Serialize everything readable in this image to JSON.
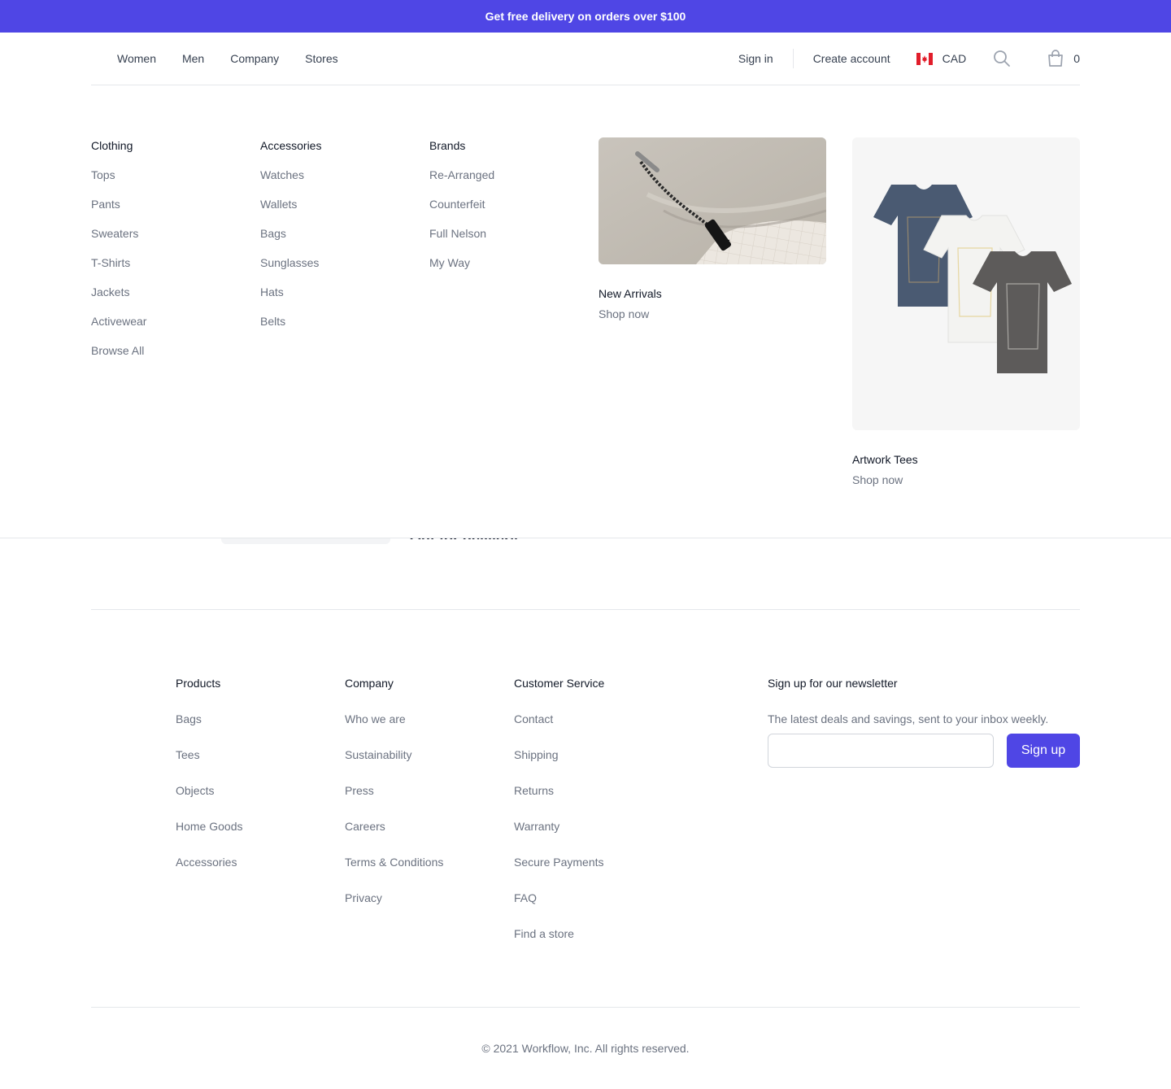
{
  "promo": {
    "text": "Get free delivery on orders over $100"
  },
  "nav": {
    "items": [
      "Women",
      "Men",
      "Company",
      "Stores"
    ]
  },
  "account": {
    "sign_in": "Sign in",
    "create_account": "Create account"
  },
  "currency": {
    "code": "CAD",
    "flag": "canada-flag"
  },
  "cart": {
    "count": "0"
  },
  "menu": {
    "columns": [
      {
        "title": "Clothing",
        "items": [
          "Tops",
          "Pants",
          "Sweaters",
          "T-Shirts",
          "Jackets",
          "Activewear",
          "Browse All"
        ]
      },
      {
        "title": "Accessories",
        "items": [
          "Watches",
          "Wallets",
          "Bags",
          "Sunglasses",
          "Hats",
          "Belts"
        ]
      },
      {
        "title": "Brands",
        "items": [
          "Re-Arranged",
          "Counterfeit",
          "Full Nelson",
          "My Way"
        ]
      }
    ],
    "features": [
      {
        "title": "New Arrivals",
        "cta": "Shop now"
      },
      {
        "title": "Artwork Tees",
        "cta": "Shop now"
      }
    ]
  },
  "behind": {
    "partial_heading": "Out for delivery"
  },
  "footer": {
    "columns": [
      {
        "title": "Products",
        "items": [
          "Bags",
          "Tees",
          "Objects",
          "Home Goods",
          "Accessories"
        ]
      },
      {
        "title": "Company",
        "items": [
          "Who we are",
          "Sustainability",
          "Press",
          "Careers",
          "Terms & Conditions",
          "Privacy"
        ]
      },
      {
        "title": "Customer Service",
        "items": [
          "Contact",
          "Shipping",
          "Returns",
          "Warranty",
          "Secure Payments",
          "FAQ",
          "Find a store"
        ]
      }
    ],
    "newsletter": {
      "title": "Sign up for our newsletter",
      "description": "The latest deals and savings, sent to your inbox weekly.",
      "input_value": "",
      "button": "Sign up"
    },
    "copyright": "© 2021 Workflow, Inc. All rights reserved."
  },
  "colors": {
    "brand": "#4f46e5",
    "border": "#e5e7eb",
    "muted_text": "#6b7280",
    "flag_red": "#e11d2a"
  }
}
